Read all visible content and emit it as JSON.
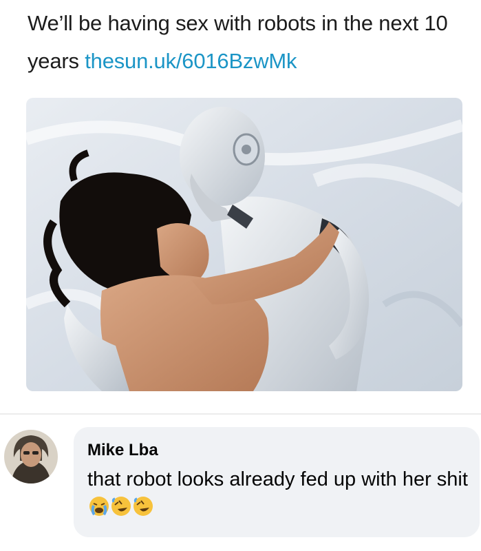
{
  "post": {
    "text": "We’ll be having sex with robots in the next 10 years",
    "link": "thesun.uk/6016BzwMk"
  },
  "photo": {
    "icon": "photo-bed-robot-woman"
  },
  "comment": {
    "author": "Mike Lba",
    "text": "that robot looks already fed up with her shit",
    "emojis": [
      "crying-face-emoji",
      "rolling-on-floor-laughing-emoji",
      "rolling-on-floor-laughing-emoji"
    ]
  },
  "colors": {
    "link": "#1b95c6",
    "bubble": "#f0f2f5",
    "text": "#1c1c1c"
  }
}
